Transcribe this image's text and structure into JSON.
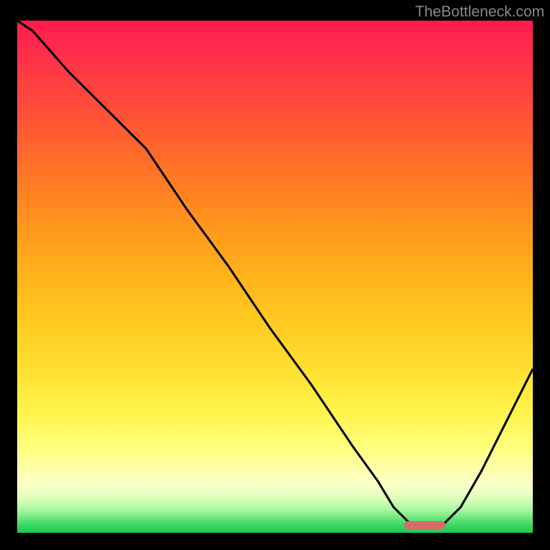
{
  "watermark": "TheBottleneck.com",
  "chart_data": {
    "type": "line",
    "title": "",
    "xlabel": "",
    "ylabel": "",
    "xlim": [
      0,
      100
    ],
    "ylim": [
      0,
      100
    ],
    "x": [
      0,
      3,
      10,
      18,
      25,
      33,
      41,
      49,
      57,
      65,
      70,
      73,
      76,
      80,
      82,
      86,
      90,
      94,
      98,
      100
    ],
    "values": [
      100,
      98,
      90,
      82,
      75,
      63,
      52,
      40,
      29,
      17,
      10,
      5,
      2,
      1,
      1,
      5,
      12,
      20,
      28,
      32
    ],
    "marker": {
      "x_start": 75,
      "x_end": 83,
      "y": 1.5
    },
    "colors": {
      "top": "#ff1a4d",
      "mid": "#ffe030",
      "bottom": "#1fc852",
      "curve": "#000000",
      "marker": "#d86a6a",
      "frame": "#000000"
    }
  }
}
